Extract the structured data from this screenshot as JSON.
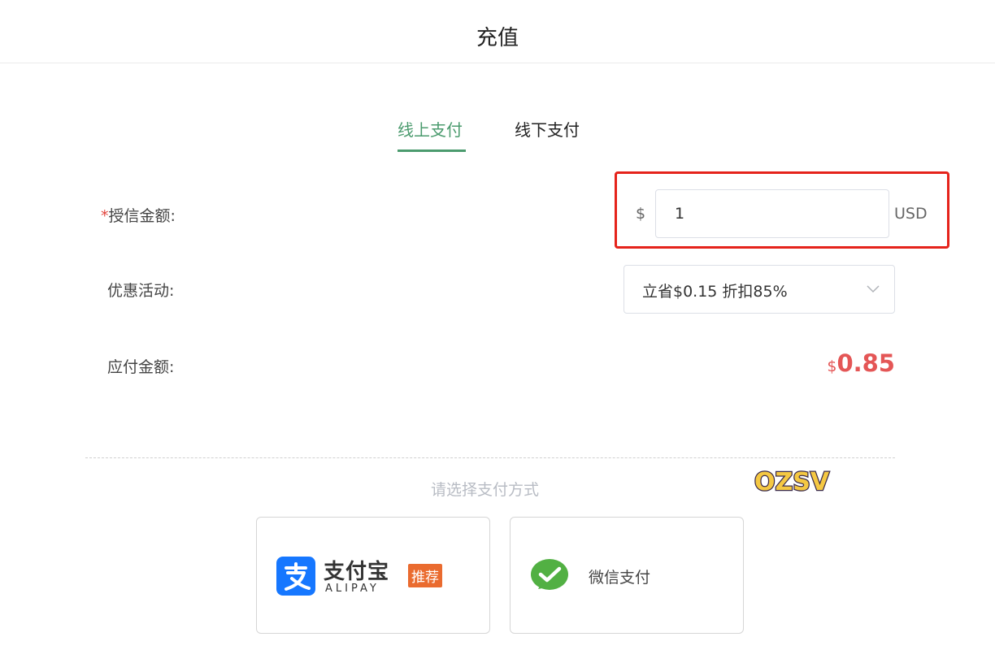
{
  "header": {
    "title": "充值"
  },
  "tabs": [
    {
      "label": "线上支付",
      "active": true
    },
    {
      "label": "线下支付",
      "active": false
    }
  ],
  "form": {
    "amount": {
      "required_mark": "*",
      "label": "授信金额:",
      "currency_sign": "$",
      "value": "1",
      "unit": "USD"
    },
    "promo": {
      "label": "优惠活动:",
      "selected": "立省$0.15 折扣85%"
    },
    "payable": {
      "label": "应付金额:",
      "currency_sign": "$",
      "value": "0.85"
    }
  },
  "payment": {
    "prompt": "请选择支付方式",
    "methods": [
      {
        "name_cn": "支付宝",
        "name_en": "ALIPAY",
        "badge": "推荐",
        "icon": "alipay-icon"
      },
      {
        "name_cn": "微信支付",
        "icon": "wechat-icon"
      }
    ]
  },
  "sticker": {
    "text": "OZSV"
  },
  "colors": {
    "accent_green": "#4b9b6e",
    "price_red": "#e45656",
    "highlight_red": "#e5231b",
    "alipay_blue": "#1677ff",
    "wechat_green": "#52b043",
    "badge_orange": "#ea6b2f"
  }
}
